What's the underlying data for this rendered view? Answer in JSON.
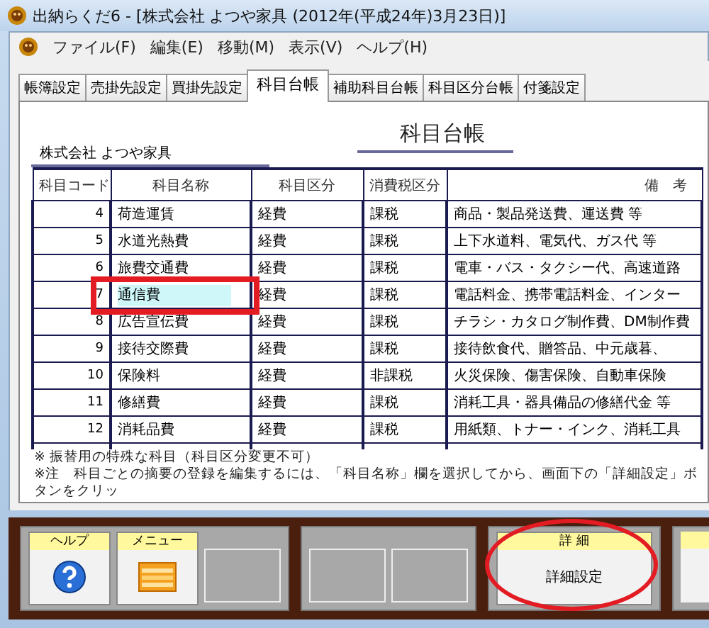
{
  "window": {
    "title": "出納らくだ6 - [株式会社 よつや家具 (2012年(平成24年)3月23日)]"
  },
  "menu": [
    "ファイル(F)",
    "編集(E)",
    "移動(M)",
    "表示(V)",
    "ヘルプ(H)"
  ],
  "tabs": [
    {
      "label": "帳簿設定",
      "selected": false
    },
    {
      "label": "売掛先設定",
      "selected": false
    },
    {
      "label": "買掛先設定",
      "selected": false
    },
    {
      "label": "科目台帳",
      "selected": true
    },
    {
      "label": "補助科目台帳",
      "selected": false
    },
    {
      "label": "科目区分台帳",
      "selected": false
    },
    {
      "label": "付箋設定",
      "selected": false
    }
  ],
  "report": {
    "title": "科目台帳",
    "company": "株式会社 よつや家具"
  },
  "table": {
    "columns": [
      "科目コード",
      "科目名称",
      "科目区分",
      "消費税区分",
      "備　考"
    ],
    "rows": [
      {
        "code": "4",
        "name": "荷造運賃",
        "category": "経費",
        "tax": "課税",
        "note": "商品・製品発送費、運送費 等",
        "selected": false
      },
      {
        "code": "5",
        "name": "水道光熱費",
        "category": "経費",
        "tax": "課税",
        "note": "上下水道料、電気代、ガス代 等",
        "selected": false
      },
      {
        "code": "6",
        "name": "旅費交通費",
        "category": "経費",
        "tax": "課税",
        "note": "電車・バス・タクシー代、高速道路",
        "selected": false
      },
      {
        "code": "7",
        "name": "通信費",
        "category": "経費",
        "tax": "課税",
        "note": "電話料金、携帯電話料金、インター",
        "selected": true
      },
      {
        "code": "8",
        "name": "広告宣伝費",
        "category": "経費",
        "tax": "課税",
        "note": "チラシ・カタログ制作費、DM制作費",
        "selected": false
      },
      {
        "code": "9",
        "name": "接待交際費",
        "category": "経費",
        "tax": "課税",
        "note": "接待飲食代、贈答品、中元歳暮、",
        "selected": false
      },
      {
        "code": "10",
        "name": "保険料",
        "category": "経費",
        "tax": "非課税",
        "note": "火災保険、傷害保険、自動車保険",
        "selected": false
      },
      {
        "code": "11",
        "name": "修繕費",
        "category": "経費",
        "tax": "課税",
        "note": "消耗工具・器具備品の修繕代金 等",
        "selected": false
      },
      {
        "code": "12",
        "name": "消耗品費",
        "category": "経費",
        "tax": "課税",
        "note": "用紙類、トナー・インク、消耗工具",
        "selected": false
      }
    ]
  },
  "notes": [
    "※ 振替用の特殊な科目（科目区分変更不可）",
    "※注　科目ごとの摘要の登録を編集するには、「科目名称」欄を選択してから、画面下の「詳細設定」ボタンをクリッ"
  ],
  "toolbar": [
    {
      "buttons": [
        {
          "kind": "help",
          "header": "ヘルプ"
        },
        {
          "kind": "menu",
          "header": "メニュー"
        },
        {
          "kind": "empty"
        }
      ]
    },
    {
      "buttons": [
        {
          "kind": "empty"
        },
        {
          "kind": "empty"
        }
      ]
    },
    {
      "buttons": [
        {
          "kind": "text",
          "header": "詳 細",
          "label": "詳細設定"
        }
      ]
    },
    {
      "buttons": [
        {
          "kind": "partial"
        }
      ]
    }
  ]
}
